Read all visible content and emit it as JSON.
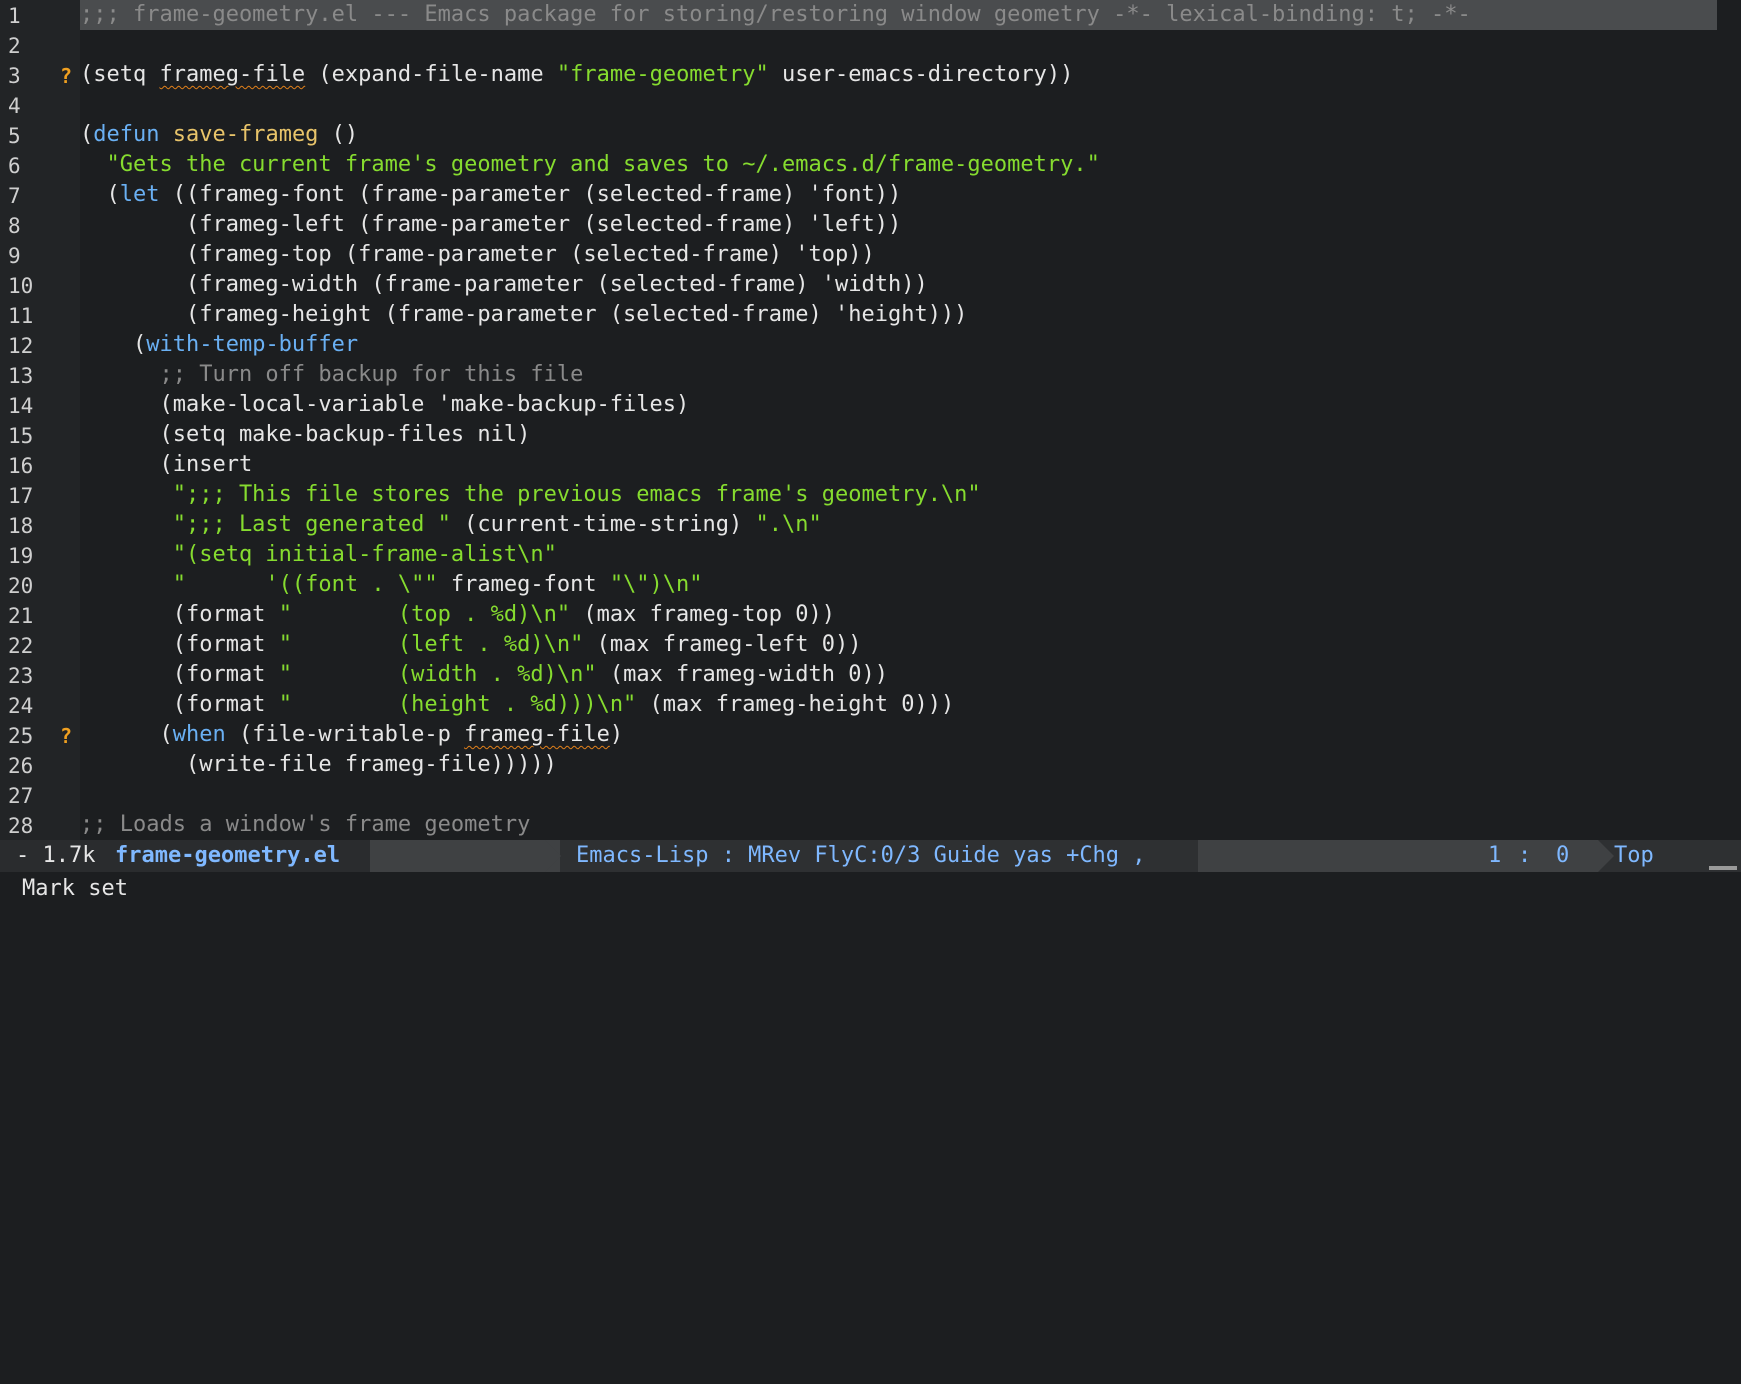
{
  "editor": {
    "lines": [
      {
        "num": "1",
        "mark": "",
        "tokens": [
          {
            "t": ";;; frame-geometry.el --- Emacs package for storing/restoring window geometry -*- lexical-binding: t; -*-",
            "c": "comment"
          }
        ]
      },
      {
        "num": "2",
        "mark": "",
        "tokens": []
      },
      {
        "num": "3",
        "mark": "?",
        "tokens": [
          {
            "t": "(setq ",
            "c": "plain"
          },
          {
            "t": "frameg-file",
            "c": "plain",
            "w": true
          },
          {
            "t": " (expand-file-name ",
            "c": "plain"
          },
          {
            "t": "\"frame-geometry\"",
            "c": "string"
          },
          {
            "t": " user-emacs-directory))",
            "c": "plain"
          }
        ]
      },
      {
        "num": "4",
        "mark": "",
        "tokens": []
      },
      {
        "num": "5",
        "mark": "",
        "tokens": [
          {
            "t": "(",
            "c": "plain"
          },
          {
            "t": "defun",
            "c": "kw"
          },
          {
            "t": " ",
            "c": "plain"
          },
          {
            "t": "save-frameg",
            "c": "fn"
          },
          {
            "t": " ()",
            "c": "plain"
          }
        ]
      },
      {
        "num": "6",
        "mark": "",
        "tokens": [
          {
            "t": "  \"Gets the current frame's geometry and saves to ~/.emacs.d/frame-geometry.\"",
            "c": "string"
          }
        ]
      },
      {
        "num": "7",
        "mark": "",
        "tokens": [
          {
            "t": "  (",
            "c": "plain"
          },
          {
            "t": "let",
            "c": "kw"
          },
          {
            "t": " ((frameg-font (frame-parameter (selected-frame) 'font))",
            "c": "plain"
          }
        ]
      },
      {
        "num": "8",
        "mark": "",
        "tokens": [
          {
            "t": "        (frameg-left (frame-parameter (selected-frame) 'left))",
            "c": "plain"
          }
        ]
      },
      {
        "num": "9",
        "mark": "",
        "tokens": [
          {
            "t": "        (frameg-top (frame-parameter (selected-frame) 'top))",
            "c": "plain"
          }
        ]
      },
      {
        "num": "10",
        "mark": "",
        "tokens": [
          {
            "t": "        (frameg-width (frame-parameter (selected-frame) 'width))",
            "c": "plain"
          }
        ]
      },
      {
        "num": "11",
        "mark": "",
        "tokens": [
          {
            "t": "        (frameg-height (frame-parameter (selected-frame) 'height)))",
            "c": "plain"
          }
        ]
      },
      {
        "num": "12",
        "mark": "",
        "tokens": [
          {
            "t": "    (",
            "c": "plain"
          },
          {
            "t": "with-temp-buffer",
            "c": "kw"
          }
        ]
      },
      {
        "num": "13",
        "mark": "",
        "tokens": [
          {
            "t": "      ;; Turn off backup for this file",
            "c": "comment"
          }
        ]
      },
      {
        "num": "14",
        "mark": "",
        "tokens": [
          {
            "t": "      (make-local-variable 'make-backup-files)",
            "c": "plain"
          }
        ]
      },
      {
        "num": "15",
        "mark": "",
        "tokens": [
          {
            "t": "      (setq make-backup-files nil)",
            "c": "plain"
          }
        ]
      },
      {
        "num": "16",
        "mark": "",
        "tokens": [
          {
            "t": "      (insert",
            "c": "plain"
          }
        ]
      },
      {
        "num": "17",
        "mark": "",
        "tokens": [
          {
            "t": "       \";;; This file stores the previous emacs frame's geometry.\\n\"",
            "c": "string"
          }
        ]
      },
      {
        "num": "18",
        "mark": "",
        "tokens": [
          {
            "t": "       \";;; Last generated \"",
            "c": "string"
          },
          {
            "t": " (current-time-string) ",
            "c": "plain"
          },
          {
            "t": "\".\\n\"",
            "c": "string"
          }
        ]
      },
      {
        "num": "19",
        "mark": "",
        "tokens": [
          {
            "t": "       \"(setq initial-frame-alist\\n\"",
            "c": "string"
          }
        ]
      },
      {
        "num": "20",
        "mark": "",
        "tokens": [
          {
            "t": "       \"      '((font . \\\"\"",
            "c": "string"
          },
          {
            "t": " frameg-font ",
            "c": "plain"
          },
          {
            "t": "\"\\\")\\n\"",
            "c": "string"
          }
        ]
      },
      {
        "num": "21",
        "mark": "",
        "tokens": [
          {
            "t": "       (format ",
            "c": "plain"
          },
          {
            "t": "\"        (top . %d)\\n\"",
            "c": "string"
          },
          {
            "t": " (max frameg-top 0))",
            "c": "plain"
          }
        ]
      },
      {
        "num": "22",
        "mark": "",
        "tokens": [
          {
            "t": "       (format ",
            "c": "plain"
          },
          {
            "t": "\"        (left . %d)\\n\"",
            "c": "string"
          },
          {
            "t": " (max frameg-left 0))",
            "c": "plain"
          }
        ]
      },
      {
        "num": "23",
        "mark": "",
        "tokens": [
          {
            "t": "       (format ",
            "c": "plain"
          },
          {
            "t": "\"        (width . %d)\\n\"",
            "c": "string"
          },
          {
            "t": " (max frameg-width 0))",
            "c": "plain"
          }
        ]
      },
      {
        "num": "24",
        "mark": "",
        "tokens": [
          {
            "t": "       (format ",
            "c": "plain"
          },
          {
            "t": "\"        (height . %d)))\\n\"",
            "c": "string"
          },
          {
            "t": " (max frameg-height 0)))",
            "c": "plain"
          }
        ]
      },
      {
        "num": "25",
        "mark": "?",
        "tokens": [
          {
            "t": "      (",
            "c": "plain"
          },
          {
            "t": "when",
            "c": "kw"
          },
          {
            "t": " (file-writable-p ",
            "c": "plain"
          },
          {
            "t": "frameg-file",
            "c": "plain",
            "w": true
          },
          {
            "t": ")",
            "c": "plain"
          }
        ]
      },
      {
        "num": "26",
        "mark": "",
        "tokens": [
          {
            "t": "        (write-file frameg-file)))))",
            "c": "plain"
          }
        ]
      },
      {
        "num": "27",
        "mark": "",
        "tokens": []
      },
      {
        "num": "28",
        "mark": "",
        "tokens": [
          {
            "t": ";; Loads a window's frame geometry",
            "c": "comment"
          }
        ]
      }
    ]
  },
  "modeline": {
    "size": "- 1.7k",
    "buffer": "frame-geometry.el",
    "modes": "Emacs-Lisp : MRev FlyC:0/3 Guide yas +Chg ,",
    "pos_line": "1",
    "pos_sep": ":",
    "pos_col": "0",
    "scroll": "Top"
  },
  "echo": {
    "message": "Mark set"
  },
  "colors": {
    "background": "#1c1e20",
    "comment": "#8a8a8a",
    "string": "#86dc2f",
    "keyword": "#6ab0f3",
    "function": "#e8c46a",
    "warning": "#f0a020"
  }
}
